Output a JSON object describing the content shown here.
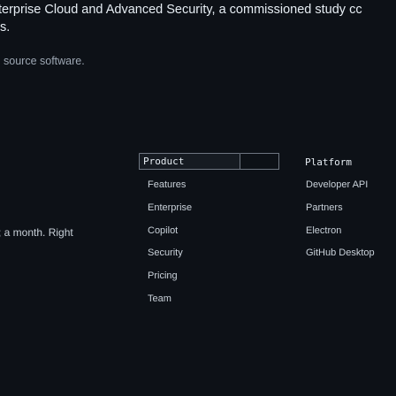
{
  "intro": {
    "line1": "terprise Cloud and Advanced Security, a commissioned study cc",
    "line2": "s.",
    "subtext": "source software."
  },
  "side": {
    "text": "; a month. Right"
  },
  "menu": {
    "search_value": "Product",
    "left_items": [
      "Features",
      "Enterprise",
      "Copilot",
      "Security",
      "Pricing",
      "Team"
    ],
    "right_header": "Platform",
    "right_items": [
      "Developer API",
      "Partners",
      "Electron",
      "GitHub Desktop"
    ]
  }
}
